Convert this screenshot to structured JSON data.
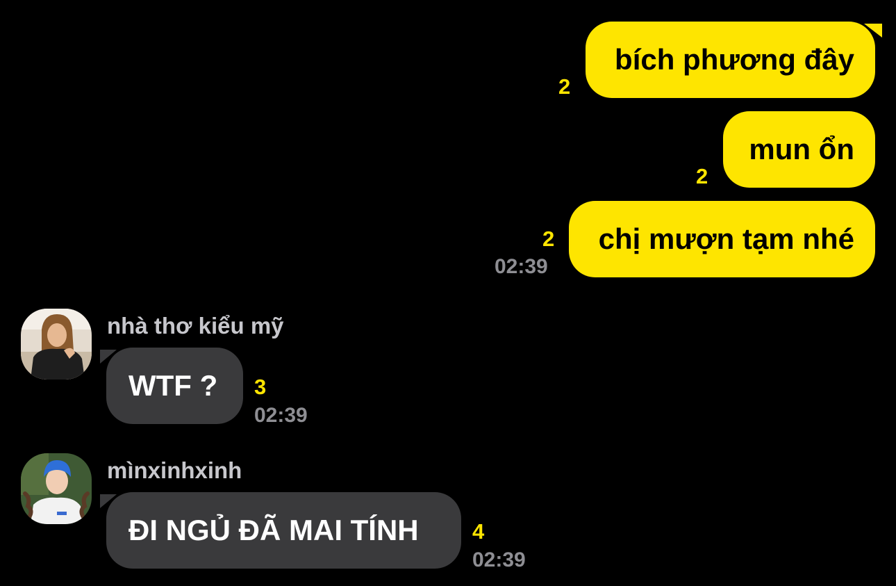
{
  "conversation": {
    "outgoing": [
      {
        "text": "bích phương đây",
        "unread": "2"
      },
      {
        "text": "mun ổn",
        "unread": "2"
      },
      {
        "text": "chị mượn tạm nhé",
        "unread": "2",
        "time": "02:39"
      }
    ],
    "incoming": [
      {
        "sender": "nhà thơ kiểu mỹ",
        "avatar_icon": "profile-photo-icon",
        "text": "WTF ?",
        "unread": "3",
        "time": "02:39"
      },
      {
        "sender": "mìnxinhxinh",
        "avatar_icon": "profile-photo-icon",
        "text": "ĐI NGỦ ĐÃ MAI TÍNH",
        "unread": "4",
        "time": "02:39"
      }
    ]
  },
  "theme": {
    "background": "#000000",
    "outgoing_bubble": "#FEE500",
    "incoming_bubble": "#3A3A3C",
    "unread_count": "#FEE500",
    "timestamp": "#8E8E93",
    "sender_name": "#C7C7CC"
  }
}
